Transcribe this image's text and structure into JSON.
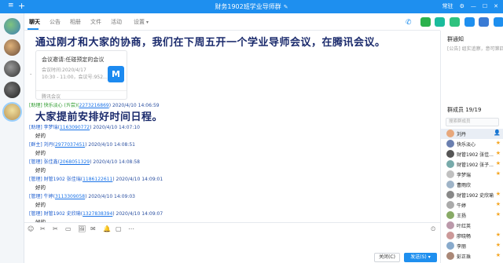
{
  "window": {
    "title": "财务1902班学业导师群",
    "menu_icon": "≡",
    "add_icon": "+",
    "edit_icon": "✎",
    "right_controls": [
      "常驻",
      "⚙",
      "—",
      "☐",
      "✕"
    ]
  },
  "tabs": [
    {
      "label": "聊天"
    },
    {
      "label": "公告"
    },
    {
      "label": "相册"
    },
    {
      "label": "文件"
    },
    {
      "label": "活动"
    },
    {
      "label": "设置"
    }
  ],
  "messages": {
    "announcement1": "通过刚才和大家的协商，我们在下周五开一个学业导师会议，在腾讯会议。",
    "card": {
      "title": "会议邀请:任碰预定的会议",
      "line1": "会议时间:2020/4/17",
      "line2": "10:30 - 11:00，会议号:952...",
      "footer": "腾讯会议",
      "logo": "M"
    },
    "dot": "·",
    "msg1": {
      "head": "[助理] 快乐淡心 (ㄞ尝)(",
      "qq": "2273216869",
      "time": ") 2020/4/10 14:06:59"
    },
    "announcement2": "大家提前安排好时间日程。",
    "msg2": {
      "head": "[助理] 李梦瑞(",
      "qq": "1163090772",
      "time": ") 2020/4/10 14:07:10",
      "body": "好的"
    },
    "msg3": {
      "head": "[群主] 刘丹(",
      "qq": "2977037451",
      "time": ") 2020/4/10 14:08:51",
      "body": "好的"
    },
    "msg4": {
      "head": "[管理] 张佳鑫(",
      "qq": "2068051329",
      "time": ") 2020/4/10 14:08:58",
      "body": "好的"
    },
    "msg5": {
      "head": "[管理] 财管1902 张佳瑞(",
      "qq": "1186122611",
      "time": ") 2020/4/10 14:09:01",
      "body": "好的"
    },
    "msg6": {
      "head": "[管理] 牛婷(",
      "qq": "3113309058",
      "time": ") 2020/4/10 14:09:03",
      "body": "好的"
    },
    "msg7": {
      "head": "[管理] 财管1902 史欣瑜(",
      "qq": "1327838394",
      "time": ") 2020/4/10 14:09:07",
      "body": "好的"
    }
  },
  "toolbar_icons": [
    "☺",
    "✂",
    "✂",
    "▭",
    "🖼",
    "✉",
    "🔔",
    "▢",
    "⋯",
    "⏲"
  ],
  "buttons": {
    "close": "关闭(C)",
    "send": "发送(S)",
    "send_caret": "▾"
  },
  "right_panel": {
    "notice_title": "群通知",
    "notice_text": "[公告] 组实追察，意可第四课",
    "members_title": "群成员 19/19",
    "search_placeholder": "搜索群成员",
    "members": [
      {
        "name": "刘丹",
        "badge": "👤",
        "color": "#e8a87c"
      },
      {
        "name": "快乐淡心",
        "badge": "★",
        "color": "#6a7fb0"
      },
      {
        "name": "财管1902 张佳...",
        "badge": "★",
        "color": "#555"
      },
      {
        "name": "财管1902 张子...",
        "badge": "★",
        "color": "#7aa"
      },
      {
        "name": "李梦瑞",
        "badge": "★",
        "color": "#c0c0c0"
      },
      {
        "name": "曹雨欣",
        "badge": "",
        "color": "#9fb4c8"
      },
      {
        "name": "财管1902 史欣瑜",
        "badge": "★",
        "color": "#888"
      },
      {
        "name": "牛婷",
        "badge": "★",
        "color": "#aaa"
      },
      {
        "name": "王扬",
        "badge": "★",
        "color": "#8a6"
      },
      {
        "name": "叶红英",
        "badge": "",
        "color": "#b9a"
      },
      {
        "name": "廖晓畅",
        "badge": "★",
        "color": "#c99"
      },
      {
        "name": "李丽",
        "badge": "★",
        "color": "#8ac"
      },
      {
        "name": "彭正珠",
        "badge": "★",
        "color": "#a87"
      }
    ]
  },
  "colors": {
    "accent": "#1e8fef",
    "title_bar": "#1e8fef",
    "bold_text": "#1a2a6c"
  }
}
